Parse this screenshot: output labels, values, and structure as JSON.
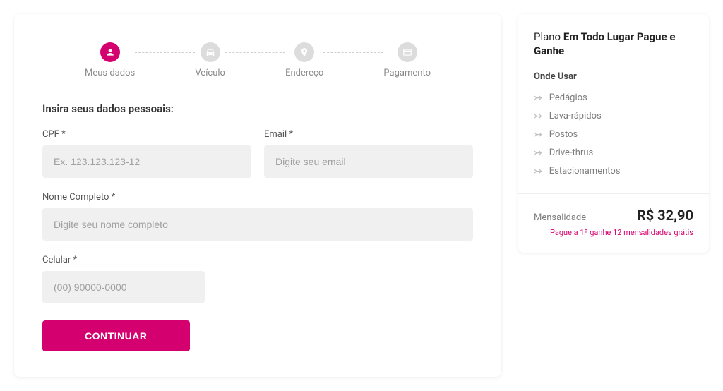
{
  "stepper": {
    "steps": [
      {
        "label": "Meus dados",
        "active": true
      },
      {
        "label": "Veículo",
        "active": false
      },
      {
        "label": "Endereço",
        "active": false
      },
      {
        "label": "Pagamento",
        "active": false
      }
    ]
  },
  "form": {
    "title": "Insira seus dados pessoais:",
    "cpf": {
      "label": "CPF *",
      "placeholder": "Ex. 123.123.123-12",
      "value": ""
    },
    "email": {
      "label": "Email *",
      "placeholder": "Digite seu email",
      "value": ""
    },
    "nome": {
      "label": "Nome Completo *",
      "placeholder": "Digite seu nome completo",
      "value": ""
    },
    "celular": {
      "label": "Celular *",
      "placeholder": "(00) 90000-0000",
      "value": ""
    },
    "submit_label": "CONTINUAR"
  },
  "sidebar": {
    "plan_prefix": "Plano",
    "plan_name": "Em Todo Lugar Pague e Ganhe",
    "onde_title": "Onde Usar",
    "onde_items": [
      "Pedágios",
      "Lava-rápidos",
      "Postos",
      "Drive-thrus",
      "Estacionamentos"
    ],
    "price_label": "Mensalidade",
    "price_value": "R$ 32,90",
    "promo": "Pague a 1ª ganhe 12 mensalidades grátis"
  }
}
